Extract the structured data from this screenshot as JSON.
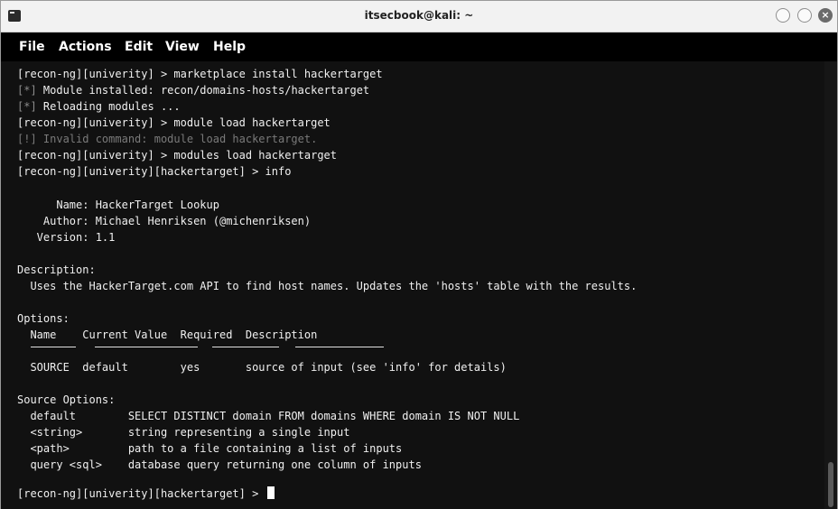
{
  "window": {
    "title": "itsecbook@kali: ~"
  },
  "menu": {
    "items": [
      "File",
      "Actions",
      "Edit",
      "View",
      "Help"
    ]
  },
  "terminal": {
    "l1": "[recon-ng][univerity] > marketplace install hackertarget",
    "l2_prefix": "[*]",
    "l2_text": " Module installed: recon/domains-hosts/hackertarget",
    "l3_prefix": "[*]",
    "l3_text": " Reloading modules ...",
    "l4": "[recon-ng][univerity] > module load hackertarget",
    "l5": "[!] Invalid command: module load hackertarget.",
    "l6": "[recon-ng][univerity] > modules load hackertarget",
    "l7": "[recon-ng][univerity][hackertarget] > info",
    "name": "      Name: HackerTarget Lookup",
    "author": "    Author: Michael Henriksen (@michenriksen)",
    "version": "   Version: 1.1",
    "description_header": "Description:",
    "description_text": "  Uses the HackerTarget.com API to find host names. Updates the 'hosts' table with the results.",
    "options_header": "Options:",
    "options_columns": "  Name    Current Value  Required  Description",
    "options_row": "  SOURCE  default        yes       source of input (see 'info' for details)",
    "source_options_header": "Source Options:",
    "source_rows": [
      "  default        SELECT DISTINCT domain FROM domains WHERE domain IS NOT NULL",
      "  <string>       string representing a single input",
      "  <path>         path to a file containing a list of inputs",
      "  query <sql>    database query returning one column of inputs"
    ],
    "prompt": "[recon-ng][univerity][hackertarget] > "
  }
}
